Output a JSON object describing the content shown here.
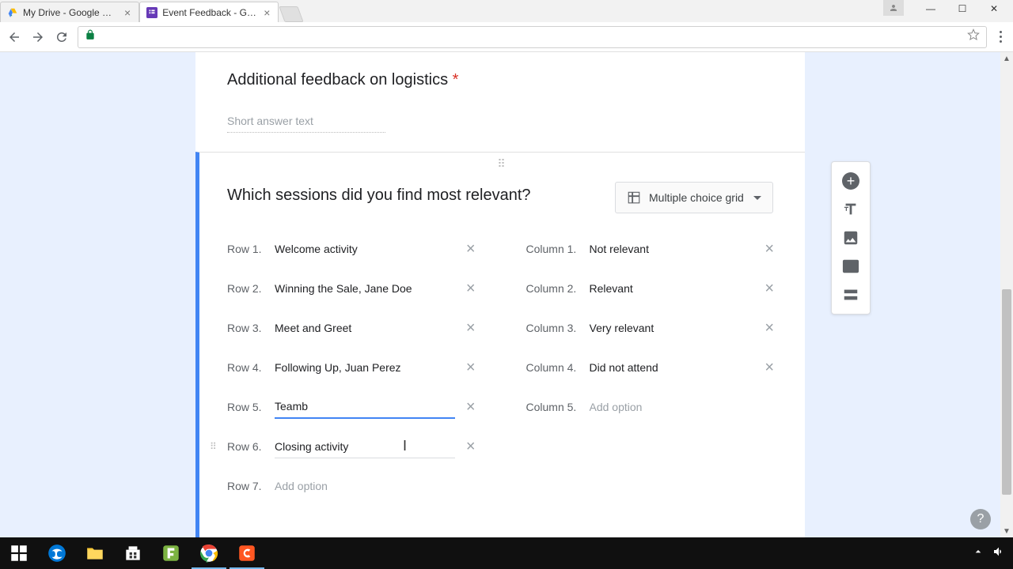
{
  "browser": {
    "tabs": [
      {
        "title": "My Drive - Google Drive",
        "active": false
      },
      {
        "title": "Event Feedback - Google",
        "active": true
      }
    ]
  },
  "question1": {
    "title": "Additional feedback on logistics",
    "placeholder": "Short answer text"
  },
  "question2": {
    "title": "Which sessions did you find most relevant?",
    "type_label": "Multiple choice grid",
    "rows": [
      {
        "label": "Row 1.",
        "value": "Welcome activity"
      },
      {
        "label": "Row 2.",
        "value": "Winning the Sale, Jane Doe"
      },
      {
        "label": "Row 3.",
        "value": "Meet and Greet"
      },
      {
        "label": "Row 4.",
        "value": "Following Up, Juan Perez"
      },
      {
        "label": "Row 5.",
        "value": "Teamb",
        "focused": true
      },
      {
        "label": "Row 6.",
        "value": "Closing activity",
        "show_drag": true,
        "cursor_hover": true
      }
    ],
    "row_add": {
      "label": "Row 7.",
      "placeholder": "Add option"
    },
    "columns": [
      {
        "label": "Column 1.",
        "value": "Not relevant"
      },
      {
        "label": "Column 2.",
        "value": "Relevant"
      },
      {
        "label": "Column 3.",
        "value": "Very relevant"
      },
      {
        "label": "Column 4.",
        "value": "Did not attend"
      }
    ],
    "col_add": {
      "label": "Column 5.",
      "placeholder": "Add option"
    }
  }
}
